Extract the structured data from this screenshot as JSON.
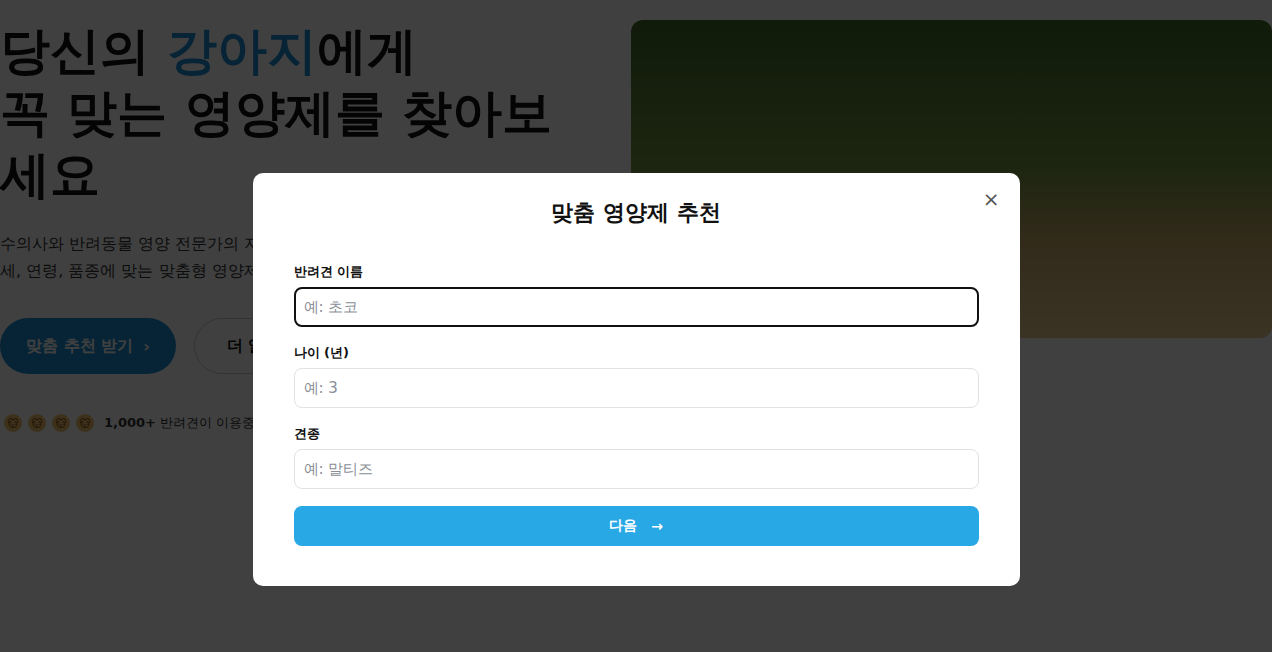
{
  "hero": {
    "title_lines": [
      [
        {
          "text": "당신의 ",
          "highlight": false
        },
        {
          "text": "강아지",
          "highlight": true
        },
        {
          "text": "에게",
          "highlight": false
        }
      ],
      [
        {
          "text": "꼭 맞는 영양제를 찾아보",
          "highlight": false
        }
      ],
      [
        {
          "text": "세요",
          "highlight": false
        }
      ]
    ],
    "subtitle_lines": [
      "수의사와 반려동물 영양 전문가의 지",
      "세, 연령, 품종에 맞는 맞춤형 영양제"
    ],
    "primary_button": {
      "label": "맞춤 추천 받기",
      "icon": "›"
    },
    "secondary_button": {
      "label": "더 알"
    },
    "user_count": "1,000+",
    "user_label": "반려견이 이용중"
  },
  "modal": {
    "title": "맞춤 영양제 추천",
    "close": "×",
    "fields": [
      {
        "label": "반려견 이름",
        "placeholder": "예: 초코",
        "focused": true
      },
      {
        "label": "나이 (년)",
        "placeholder": "예: 3",
        "focused": false
      },
      {
        "label": "견종",
        "placeholder": "예: 말티즈",
        "focused": false
      }
    ],
    "submit": {
      "label": "다음",
      "icon": "→"
    }
  }
}
